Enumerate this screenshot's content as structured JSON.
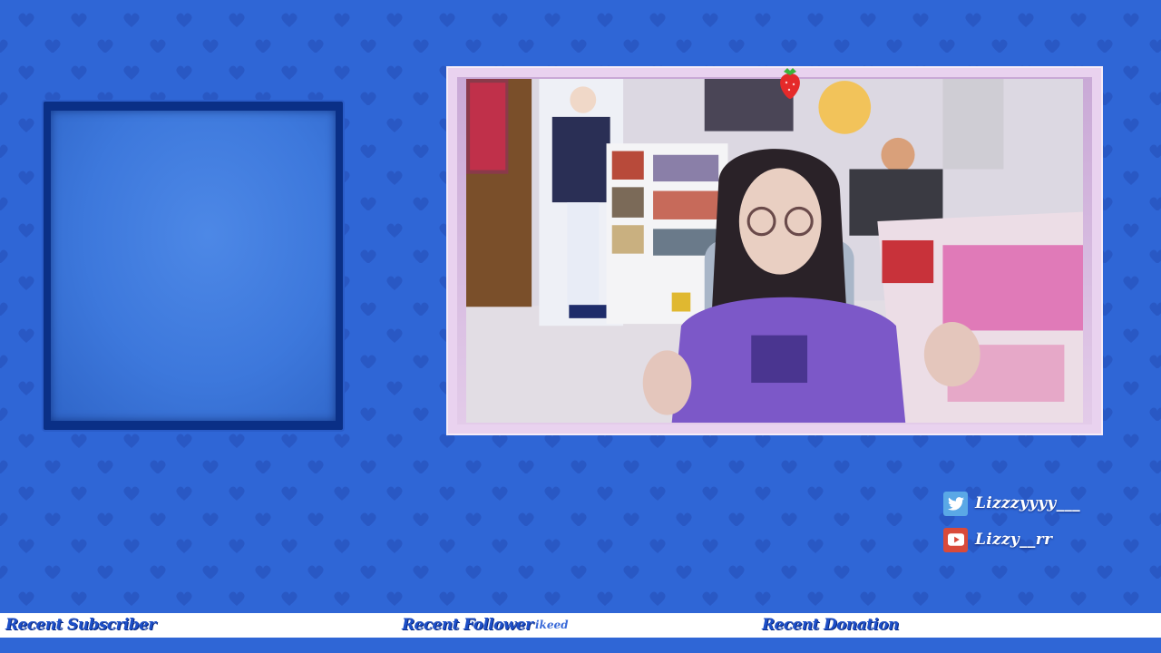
{
  "socials": [
    {
      "platform": "twitter",
      "icon": "twitter-bird-icon",
      "handle": "Lizzzyyyy___"
    },
    {
      "platform": "youtube",
      "icon": "youtube-play-icon",
      "handle": "Lizzy__rr"
    }
  ],
  "ticker": {
    "recent_subscriber_label": "Recent Subscriber",
    "recent_subscriber_value": "",
    "recent_follower_label": "Recent Follower",
    "recent_follower_value": "ikeed",
    "recent_donation_label": "Recent Donation",
    "recent_donation_value": ""
  },
  "colors": {
    "background": "#2f66d6",
    "pattern": "#2958c4",
    "panel_border": "#0a2f86",
    "cam_frame": "#e9d2ef",
    "ticker_bg": "#ffffff",
    "ticker_text": "#1d4fc8",
    "twitter": "#5aa8e6",
    "youtube": "#d94a3a"
  }
}
